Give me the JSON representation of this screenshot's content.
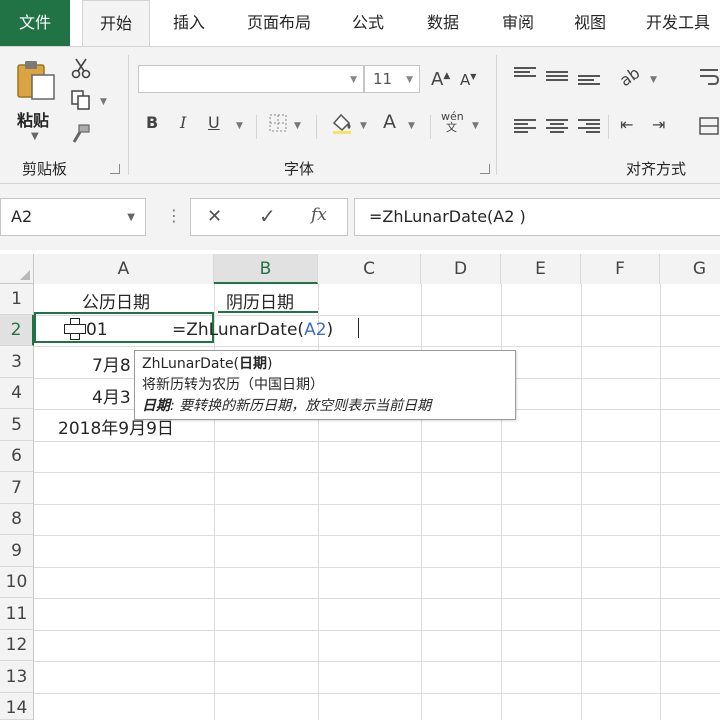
{
  "tabs": [
    {
      "label": "文件",
      "left": 0
    },
    {
      "label": "开始",
      "active": true
    },
    {
      "label": "插入"
    },
    {
      "label": "页面布局"
    },
    {
      "label": "公式"
    },
    {
      "label": "数据"
    },
    {
      "label": "审阅"
    },
    {
      "label": "视图"
    },
    {
      "label": "开发工具"
    }
  ],
  "ribbon": {
    "clipboard": {
      "paste_label": "粘贴",
      "group_label": "剪贴板"
    },
    "font": {
      "font_name": "",
      "font_size": "11",
      "group_label": "字体",
      "bold": "B",
      "italic": "I",
      "underline": "U",
      "font_color_letter": "A",
      "grow": "A",
      "shrink": "A",
      "phonetic_top": "wén",
      "phonetic_bottom": "文"
    },
    "alignment": {
      "group_label": "对齐方式"
    }
  },
  "formula_bar": {
    "name_box": "A2",
    "cancel": "✕",
    "enter": "✓",
    "fx": "fx",
    "formula": "=ZhLunarDate(A2 )"
  },
  "grid": {
    "columns": [
      "A",
      "B",
      "C",
      "D",
      "E",
      "F",
      "G"
    ],
    "rows": [
      "1",
      "2",
      "3",
      "4",
      "5",
      "6",
      "7",
      "8",
      "9",
      "10",
      "11",
      "12",
      "13",
      "14"
    ],
    "cells": {
      "A1": "公历日期",
      "B1": "阴历日期",
      "A2": "01",
      "A2_edit": "=ZhLunarDate(",
      "A2_edit_ref": "A2",
      "A2_edit_close": ")",
      "A3": "7月8",
      "A4": "4月3",
      "A5": "2018年9月9日"
    }
  },
  "tooltip": {
    "func_name": "ZhLunarDate(",
    "param": "日期",
    "close": ")",
    "summary": "将新历转为农历（中国日期）",
    "param_label": "日期",
    "param_desc": ": 要转换的新历日期，放空则表示当前日期"
  },
  "colors": {
    "accent": "#217346",
    "ribbon_bg": "#f3f3f3"
  }
}
